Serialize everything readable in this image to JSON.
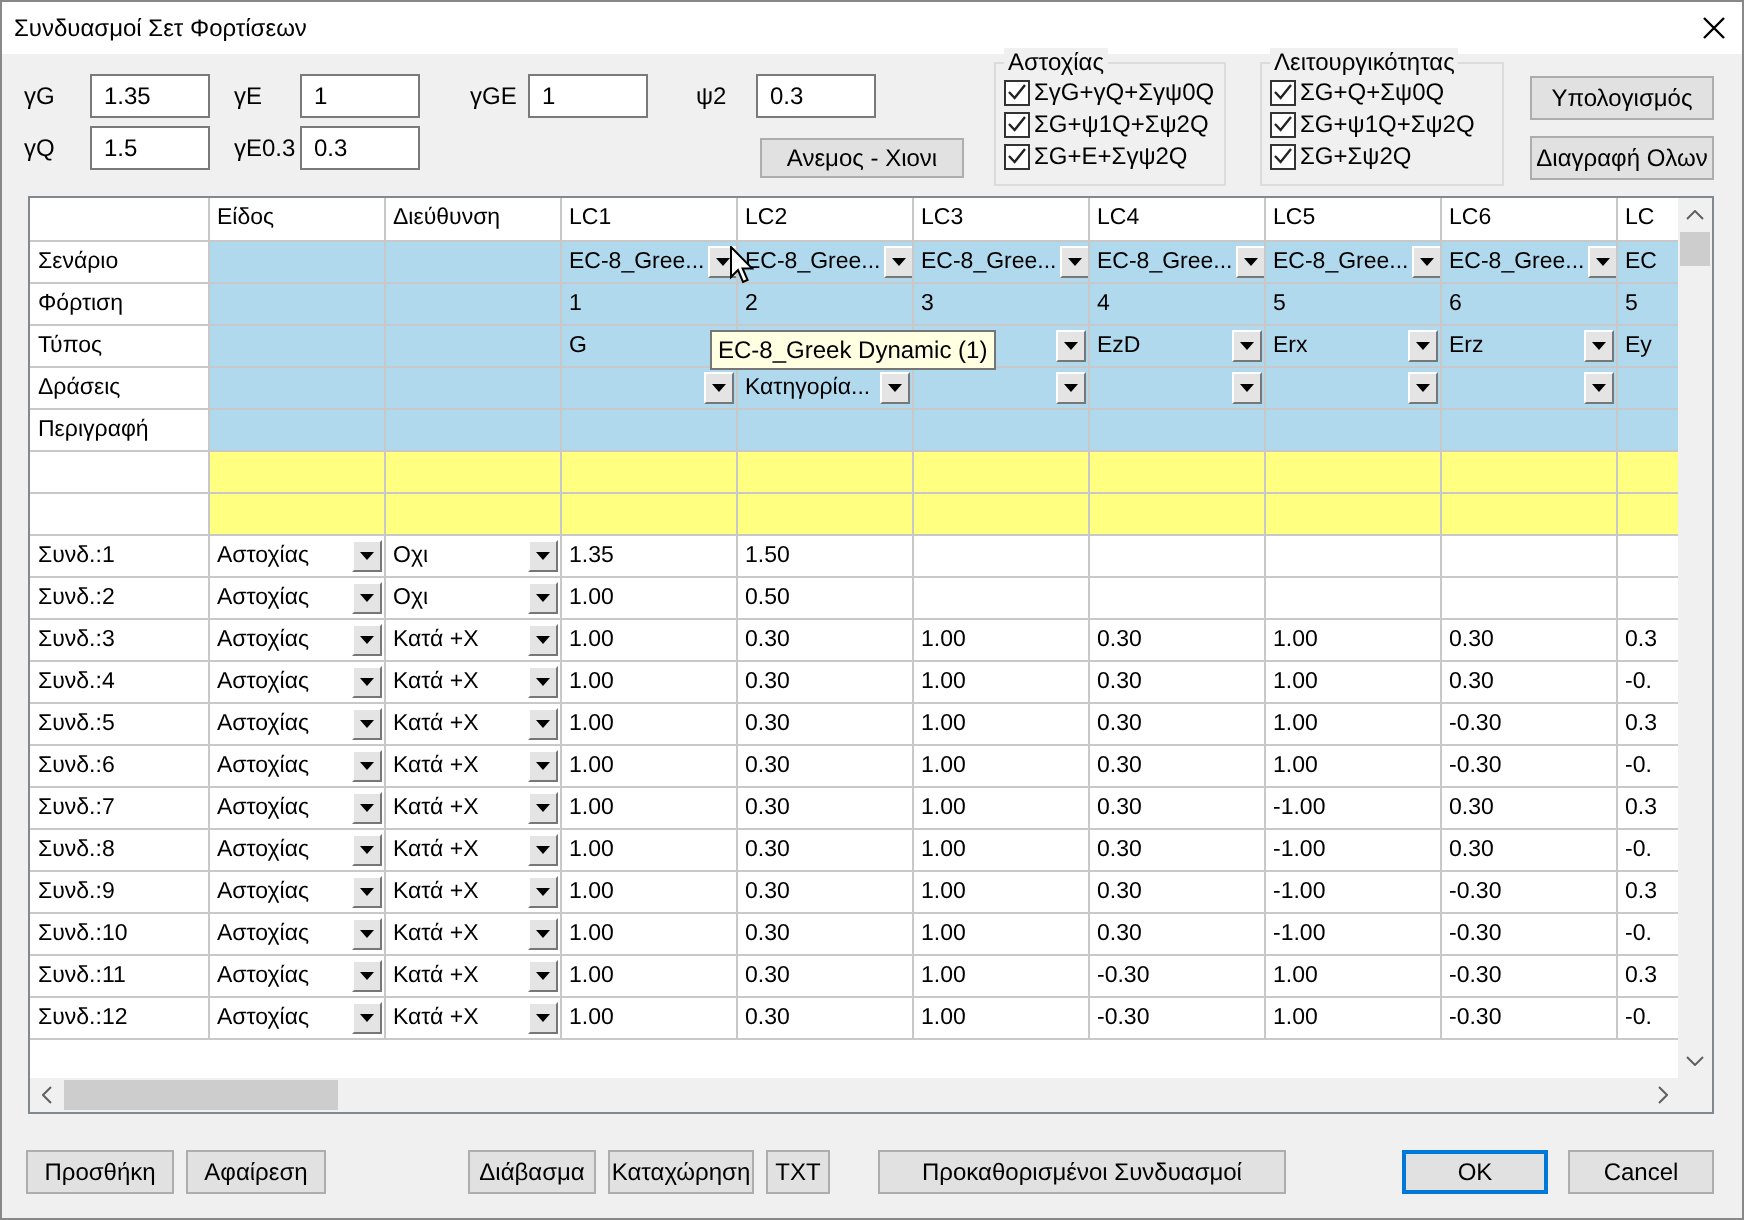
{
  "window": {
    "title": "Συνδυασμοί Σετ Φορτίσεων"
  },
  "factors": [
    {
      "label": "γG",
      "value": "1.35"
    },
    {
      "label": "γE",
      "value": "1"
    },
    {
      "label": "γGE",
      "value": "1"
    },
    {
      "label": "ψ2",
      "value": "0.3"
    },
    {
      "label": "γQ",
      "value": "1.5"
    },
    {
      "label": "γE0.3",
      "value": "0.3"
    }
  ],
  "wind_snow_button": "Ανεμος - Χιονι",
  "groups": [
    {
      "title": "Αστοχίας",
      "options": [
        {
          "label": "ΣγG+γQ+Σγψ0Q",
          "checked": true
        },
        {
          "label": "ΣG+ψ1Q+Σψ2Q",
          "checked": true
        },
        {
          "label": "ΣG+E+Σγψ2Q",
          "checked": true
        }
      ]
    },
    {
      "title": "Λειτουργικότητας",
      "options": [
        {
          "label": "ΣG+Q+Σψ0Q",
          "checked": true
        },
        {
          "label": "ΣG+ψ1Q+Σψ2Q",
          "checked": true
        },
        {
          "label": "ΣG+Σψ2Q",
          "checked": true
        }
      ]
    }
  ],
  "side_buttons": [
    "Υπολογισμός",
    "Διαγραφή Ολων"
  ],
  "table": {
    "columns": [
      "Είδος",
      "Διεύθυνση",
      "LC1",
      "LC2",
      "LC3",
      "LC4",
      "LC5",
      "LC6",
      "LC"
    ],
    "property_rows": [
      {
        "label": "Σενάριο",
        "cells": [
          {
            "kind": "blank"
          },
          {
            "kind": "blank"
          },
          {
            "kind": "dropdown",
            "text": "EC-8_Gree..."
          },
          {
            "kind": "dropdown",
            "text": "EC-8_Gree..."
          },
          {
            "kind": "dropdown",
            "text": "EC-8_Gree..."
          },
          {
            "kind": "dropdown",
            "text": "EC-8_Gree..."
          },
          {
            "kind": "dropdown",
            "text": "EC-8_Gree..."
          },
          {
            "kind": "dropdown",
            "text": "EC-8_Gree..."
          },
          {
            "kind": "text",
            "text": "EC"
          }
        ]
      },
      {
        "label": "Φόρτιση",
        "cells": [
          {
            "kind": "blank"
          },
          {
            "kind": "blank"
          },
          {
            "kind": "text",
            "text": "1"
          },
          {
            "kind": "text",
            "text": "2"
          },
          {
            "kind": "text",
            "text": "3"
          },
          {
            "kind": "text",
            "text": "4"
          },
          {
            "kind": "text",
            "text": "5"
          },
          {
            "kind": "text",
            "text": "6"
          },
          {
            "kind": "text",
            "text": "5"
          }
        ]
      },
      {
        "label": "Τύπος",
        "cells": [
          {
            "kind": "blank"
          },
          {
            "kind": "blank"
          },
          {
            "kind": "text",
            "text": "G"
          },
          {
            "kind": "blank"
          },
          {
            "kind": "dropdown"
          },
          {
            "kind": "dropdown",
            "text": "EzD"
          },
          {
            "kind": "dropdown",
            "text": "Erx"
          },
          {
            "kind": "dropdown",
            "text": "Erz"
          },
          {
            "kind": "text",
            "text": "Ey"
          }
        ]
      },
      {
        "label": "Δράσεις",
        "cells": [
          {
            "kind": "blank"
          },
          {
            "kind": "blank"
          },
          {
            "kind": "dropdown"
          },
          {
            "kind": "dropdown",
            "text": "Κατηγορία..."
          },
          {
            "kind": "dropdown"
          },
          {
            "kind": "dropdown"
          },
          {
            "kind": "dropdown"
          },
          {
            "kind": "dropdown"
          },
          {
            "kind": "blank"
          }
        ]
      },
      {
        "label": "Περιγραφή",
        "cells": [
          {
            "kind": "blank"
          },
          {
            "kind": "blank"
          },
          {
            "kind": "blank"
          },
          {
            "kind": "blank"
          },
          {
            "kind": "blank"
          },
          {
            "kind": "blank"
          },
          {
            "kind": "blank"
          },
          {
            "kind": "blank"
          },
          {
            "kind": "blank"
          }
        ]
      }
    ],
    "spacer_rows": [
      {
        "kind": "highlight"
      },
      {
        "kind": "highlight"
      }
    ],
    "combinations": [
      {
        "label": "Συνδ.:1",
        "type": "Αστοχίας",
        "direction": "Οχι",
        "values": [
          "1.35",
          "1.50"
        ]
      },
      {
        "label": "Συνδ.:2",
        "type": "Αστοχίας",
        "direction": "Οχι",
        "values": [
          "1.00",
          "0.50"
        ]
      },
      {
        "label": "Συνδ.:3",
        "type": "Αστοχίας",
        "direction": "Κατά +X",
        "values": [
          "1.00",
          "0.30",
          "1.00",
          "0.30",
          "1.00",
          "0.30",
          "0.3"
        ]
      },
      {
        "label": "Συνδ.:4",
        "type": "Αστοχίας",
        "direction": "Κατά +X",
        "values": [
          "1.00",
          "0.30",
          "1.00",
          "0.30",
          "1.00",
          "0.30",
          "-0."
        ]
      },
      {
        "label": "Συνδ.:5",
        "type": "Αστοχίας",
        "direction": "Κατά +X",
        "values": [
          "1.00",
          "0.30",
          "1.00",
          "0.30",
          "1.00",
          "-0.30",
          "0.3"
        ]
      },
      {
        "label": "Συνδ.:6",
        "type": "Αστοχίας",
        "direction": "Κατά +X",
        "values": [
          "1.00",
          "0.30",
          "1.00",
          "0.30",
          "1.00",
          "-0.30",
          "-0."
        ]
      },
      {
        "label": "Συνδ.:7",
        "type": "Αστοχίας",
        "direction": "Κατά +X",
        "values": [
          "1.00",
          "0.30",
          "1.00",
          "0.30",
          "-1.00",
          "0.30",
          "0.3"
        ]
      },
      {
        "label": "Συνδ.:8",
        "type": "Αστοχίας",
        "direction": "Κατά +X",
        "values": [
          "1.00",
          "0.30",
          "1.00",
          "0.30",
          "-1.00",
          "0.30",
          "-0."
        ]
      },
      {
        "label": "Συνδ.:9",
        "type": "Αστοχίας",
        "direction": "Κατά +X",
        "values": [
          "1.00",
          "0.30",
          "1.00",
          "0.30",
          "-1.00",
          "-0.30",
          "0.3"
        ]
      },
      {
        "label": "Συνδ.:10",
        "type": "Αστοχίας",
        "direction": "Κατά +X",
        "values": [
          "1.00",
          "0.30",
          "1.00",
          "0.30",
          "-1.00",
          "-0.30",
          "-0."
        ]
      },
      {
        "label": "Συνδ.:11",
        "type": "Αστοχίας",
        "direction": "Κατά +X",
        "values": [
          "1.00",
          "0.30",
          "1.00",
          "-0.30",
          "1.00",
          "-0.30",
          "0.3"
        ]
      },
      {
        "label": "Συνδ.:12",
        "type": "Αστοχίας",
        "direction": "Κατά +X",
        "values": [
          "1.00",
          "0.30",
          "1.00",
          "-0.30",
          "1.00",
          "-0.30",
          "-0."
        ]
      }
    ],
    "tooltip": "EC-8_Greek Dynamic (1)"
  },
  "button_groups": [
    [
      {
        "label": "Προσθήκη",
        "default": false
      },
      {
        "label": "Αφαίρεση",
        "default": false
      }
    ],
    [
      {
        "label": "Διάβασμα",
        "default": false
      },
      {
        "label": "Καταχώρηση",
        "default": false
      },
      {
        "label": "TXT",
        "default": false
      }
    ],
    [
      {
        "label": "Προκαθορισμένοι Συνδυασμοί",
        "default": false
      }
    ],
    [
      {
        "label": "OK",
        "default": true
      },
      {
        "label": "Cancel",
        "default": false
      }
    ]
  ]
}
